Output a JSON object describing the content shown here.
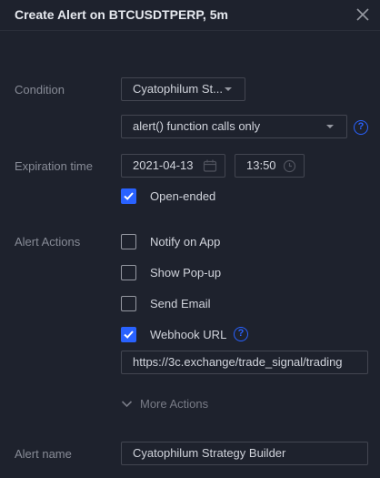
{
  "dialog": {
    "title": "Create Alert on BTCUSDTPERP, 5m",
    "close_icon": "close-icon"
  },
  "condition": {
    "label": "Condition",
    "indicator_value": "Cyatophilum St...",
    "trigger_value": "alert() function calls only",
    "help_icon": "question-circle-icon"
  },
  "expiration": {
    "label": "Expiration time",
    "date_value": "2021-04-13",
    "time_value": "13:50",
    "open_ended_label": "Open-ended",
    "open_ended_checked": true
  },
  "alert_actions": {
    "label": "Alert Actions",
    "items": [
      {
        "label": "Notify on App",
        "checked": false
      },
      {
        "label": "Show Pop-up",
        "checked": false
      },
      {
        "label": "Send Email",
        "checked": false
      },
      {
        "label": "Webhook URL",
        "checked": true
      }
    ],
    "webhook_url": "https://3c.exchange/trade_signal/trading",
    "more_actions_label": "More Actions"
  },
  "alert_name": {
    "label": "Alert name",
    "value": "Cyatophilum Strategy Builder"
  },
  "colors": {
    "background": "#1e222d",
    "accent": "#2962ff",
    "border": "#434651",
    "muted_text": "#878b96"
  }
}
